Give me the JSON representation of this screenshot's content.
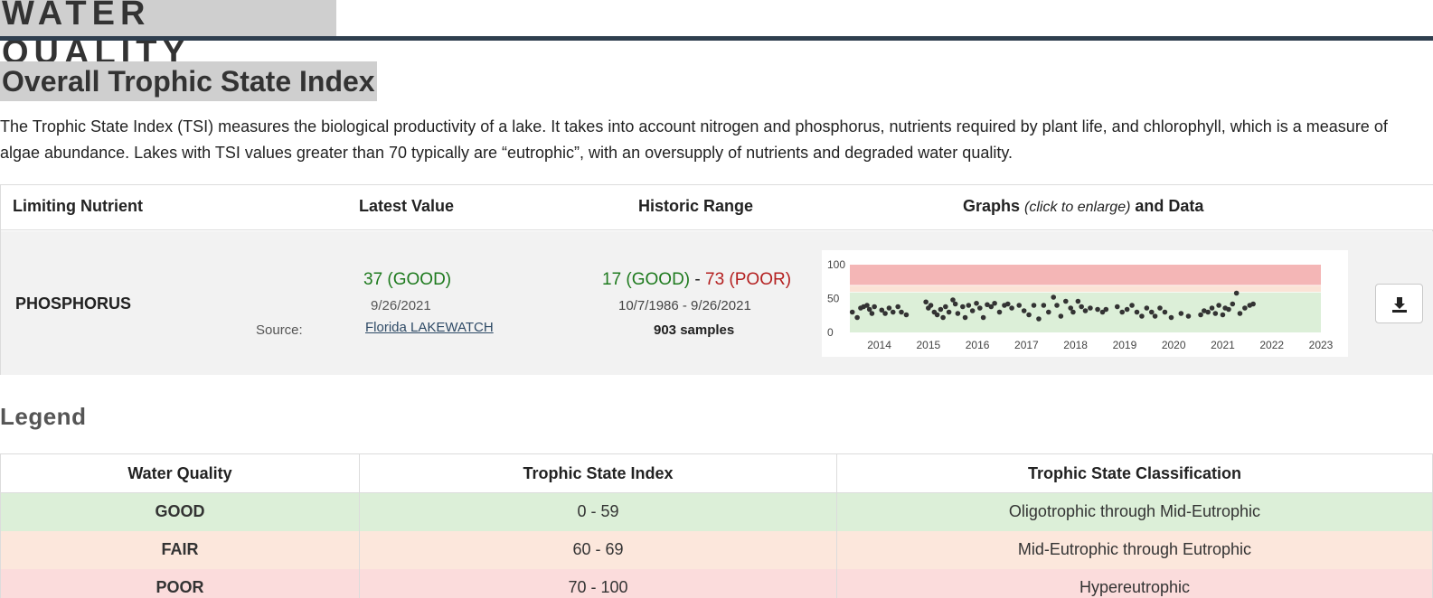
{
  "section": {
    "title": "WATER QUALITY"
  },
  "page": {
    "title": "Overall Trophic State Index",
    "description": "The Trophic State Index (TSI) measures the biological productivity of a lake. It takes into account nitrogen and phosphorus, nutrients required by plant life, and chlorophyll, which is a measure of algae abundance. Lakes with TSI values greater than 70 typically are “eutrophic”, with an oversupply of nutrients and degraded water quality."
  },
  "tsi_table": {
    "headers": {
      "nutrient": "Limiting Nutrient",
      "latest": "Latest Value",
      "range": "Historic Range",
      "graph_prefix": "Graphs",
      "graph_note": "(click to enlarge)",
      "graph_suffix": " and Data"
    },
    "row": {
      "nutrient": "PHOSPHORUS",
      "source_label": "Source:",
      "latest_value": "37 (GOOD)",
      "latest_date": "9/26/2021",
      "source_link": "Florida LAKEWATCH",
      "range_low": "17 (GOOD)",
      "range_sep": " - ",
      "range_high": "73 (POOR)",
      "range_dates": "10/7/1986 - 9/26/2021",
      "samples": "903 samples"
    },
    "download_icon": "download-icon"
  },
  "chart_data": {
    "type": "scatter",
    "xlim": [
      2013.4,
      2023.0
    ],
    "ylim": [
      0,
      100
    ],
    "y_ticks": [
      "100",
      "50",
      "0"
    ],
    "x_ticks": [
      "2014",
      "2015",
      "2016",
      "2017",
      "2018",
      "2019",
      "2020",
      "2021",
      "2022",
      "2023"
    ],
    "bands": [
      {
        "from": 0,
        "to": 59,
        "color": "#dcefd8"
      },
      {
        "from": 60,
        "to": 69,
        "color": "#fbe3d6"
      },
      {
        "from": 70,
        "to": 100,
        "color": "#f4b6b6"
      }
    ],
    "x": [
      2013.45,
      2013.55,
      2013.62,
      2013.68,
      2013.75,
      2013.8,
      2013.85,
      2013.9,
      2014.05,
      2014.12,
      2014.2,
      2014.28,
      2014.38,
      2014.45,
      2014.55,
      2014.95,
      2015.0,
      2015.05,
      2015.12,
      2015.18,
      2015.25,
      2015.3,
      2015.35,
      2015.42,
      2015.5,
      2015.55,
      2015.6,
      2015.7,
      2015.75,
      2015.82,
      2015.9,
      2015.98,
      2016.05,
      2016.12,
      2016.2,
      2016.28,
      2016.35,
      2016.45,
      2016.55,
      2016.62,
      2016.7,
      2016.85,
      2016.95,
      2017.05,
      2017.15,
      2017.25,
      2017.35,
      2017.45,
      2017.55,
      2017.62,
      2017.7,
      2017.8,
      2017.9,
      2017.95,
      2018.05,
      2018.12,
      2018.2,
      2018.3,
      2018.45,
      2018.55,
      2018.62,
      2018.85,
      2018.95,
      2019.05,
      2019.15,
      2019.25,
      2019.35,
      2019.45,
      2019.55,
      2019.62,
      2019.72,
      2019.82,
      2019.95,
      2020.15,
      2020.3,
      2020.55,
      2020.62,
      2020.7,
      2020.78,
      2020.85,
      2020.92,
      2021.0,
      2021.05,
      2021.12,
      2021.2,
      2021.28,
      2021.35,
      2021.45,
      2021.55,
      2021.62
    ],
    "y": [
      30,
      22,
      36,
      38,
      40,
      34,
      28,
      38,
      33,
      28,
      36,
      30,
      38,
      30,
      26,
      45,
      36,
      40,
      30,
      26,
      34,
      22,
      38,
      30,
      48,
      42,
      28,
      38,
      22,
      40,
      32,
      43,
      36,
      22,
      41,
      38,
      43,
      30,
      40,
      42,
      36,
      40,
      32,
      26,
      40,
      20,
      40,
      30,
      52,
      40,
      24,
      46,
      36,
      30,
      46,
      38,
      32,
      36,
      34,
      30,
      34,
      38,
      30,
      34,
      40,
      30,
      24,
      36,
      30,
      24,
      36,
      30,
      22,
      28,
      24,
      26,
      32,
      30,
      36,
      28,
      40,
      26,
      36,
      34,
      42,
      58,
      28,
      36,
      40,
      42
    ]
  },
  "legend": {
    "title": "Legend",
    "headers": [
      "Water Quality",
      "Trophic State Index",
      "Trophic State Classification"
    ],
    "rows": [
      {
        "quality": "GOOD",
        "index": "0 - 59",
        "classification": "Oligotrophic through Mid-Eutrophic"
      },
      {
        "quality": "FAIR",
        "index": "60 - 69",
        "classification": "Mid-Eutrophic through Eutrophic"
      },
      {
        "quality": "POOR",
        "index": "70 - 100",
        "classification": "Hypereutrophic"
      }
    ]
  }
}
